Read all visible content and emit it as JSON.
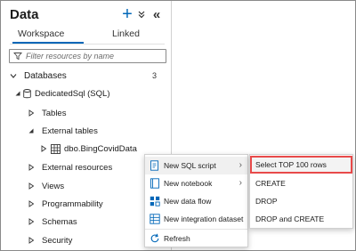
{
  "panel": {
    "title": "Data",
    "tabs": [
      {
        "label": "Workspace",
        "selected": true
      },
      {
        "label": "Linked",
        "selected": false
      }
    ],
    "filter_placeholder": "Filter resources by name"
  },
  "tree": {
    "databases_label": "Databases",
    "databases_count": "3",
    "db_name": "DedicatedSql (SQL)",
    "tables": "Tables",
    "external_tables": "External tables",
    "table_item": "dbo.BingCovidData",
    "external_resources": "External resources",
    "views": "Views",
    "programmability": "Programmability",
    "schemas": "Schemas",
    "security": "Security"
  },
  "context_menu": {
    "items": [
      {
        "label": "New SQL script",
        "icon": "sql-script-icon",
        "has_submenu": true
      },
      {
        "label": "New notebook",
        "icon": "notebook-icon",
        "has_submenu": true
      },
      {
        "label": "New data flow",
        "icon": "data-flow-icon",
        "has_submenu": false
      },
      {
        "label": "New integration dataset",
        "icon": "dataset-icon",
        "has_submenu": false
      },
      {
        "label": "Refresh",
        "icon": "refresh-icon",
        "has_submenu": false
      }
    ]
  },
  "submenu": {
    "items": [
      {
        "label": "Select TOP 100 rows",
        "highlighted": true
      },
      {
        "label": "CREATE"
      },
      {
        "label": "DROP"
      },
      {
        "label": "DROP and CREATE"
      }
    ]
  },
  "colors": {
    "accent": "#0067b8",
    "highlight_border": "#e84a4a"
  }
}
